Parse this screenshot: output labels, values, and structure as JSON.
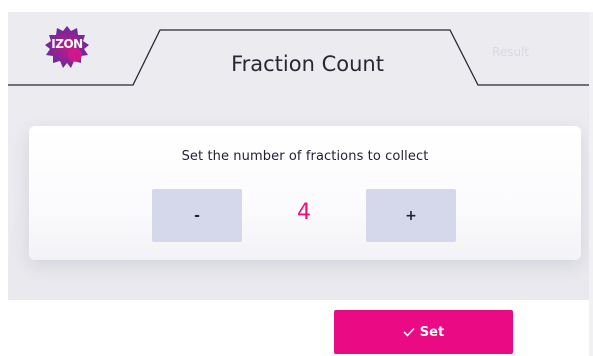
{
  "header": {
    "logo_text": "IZON",
    "tab_title": "Fraction Count",
    "ghost_tab_label": "Result"
  },
  "card": {
    "title": "Set the number of fractions to collect"
  },
  "stepper": {
    "minus_label": "-",
    "value": "4",
    "plus_label": "+"
  },
  "actions": {
    "set_label": "Set"
  },
  "colors": {
    "accent": "#ea0a84",
    "value_text": "#e5107e",
    "stepper_button": "#d5d7ea",
    "header_bg": "#ebebf0"
  },
  "icons": {
    "logo": "izon-logo-icon",
    "check": "check-icon"
  }
}
